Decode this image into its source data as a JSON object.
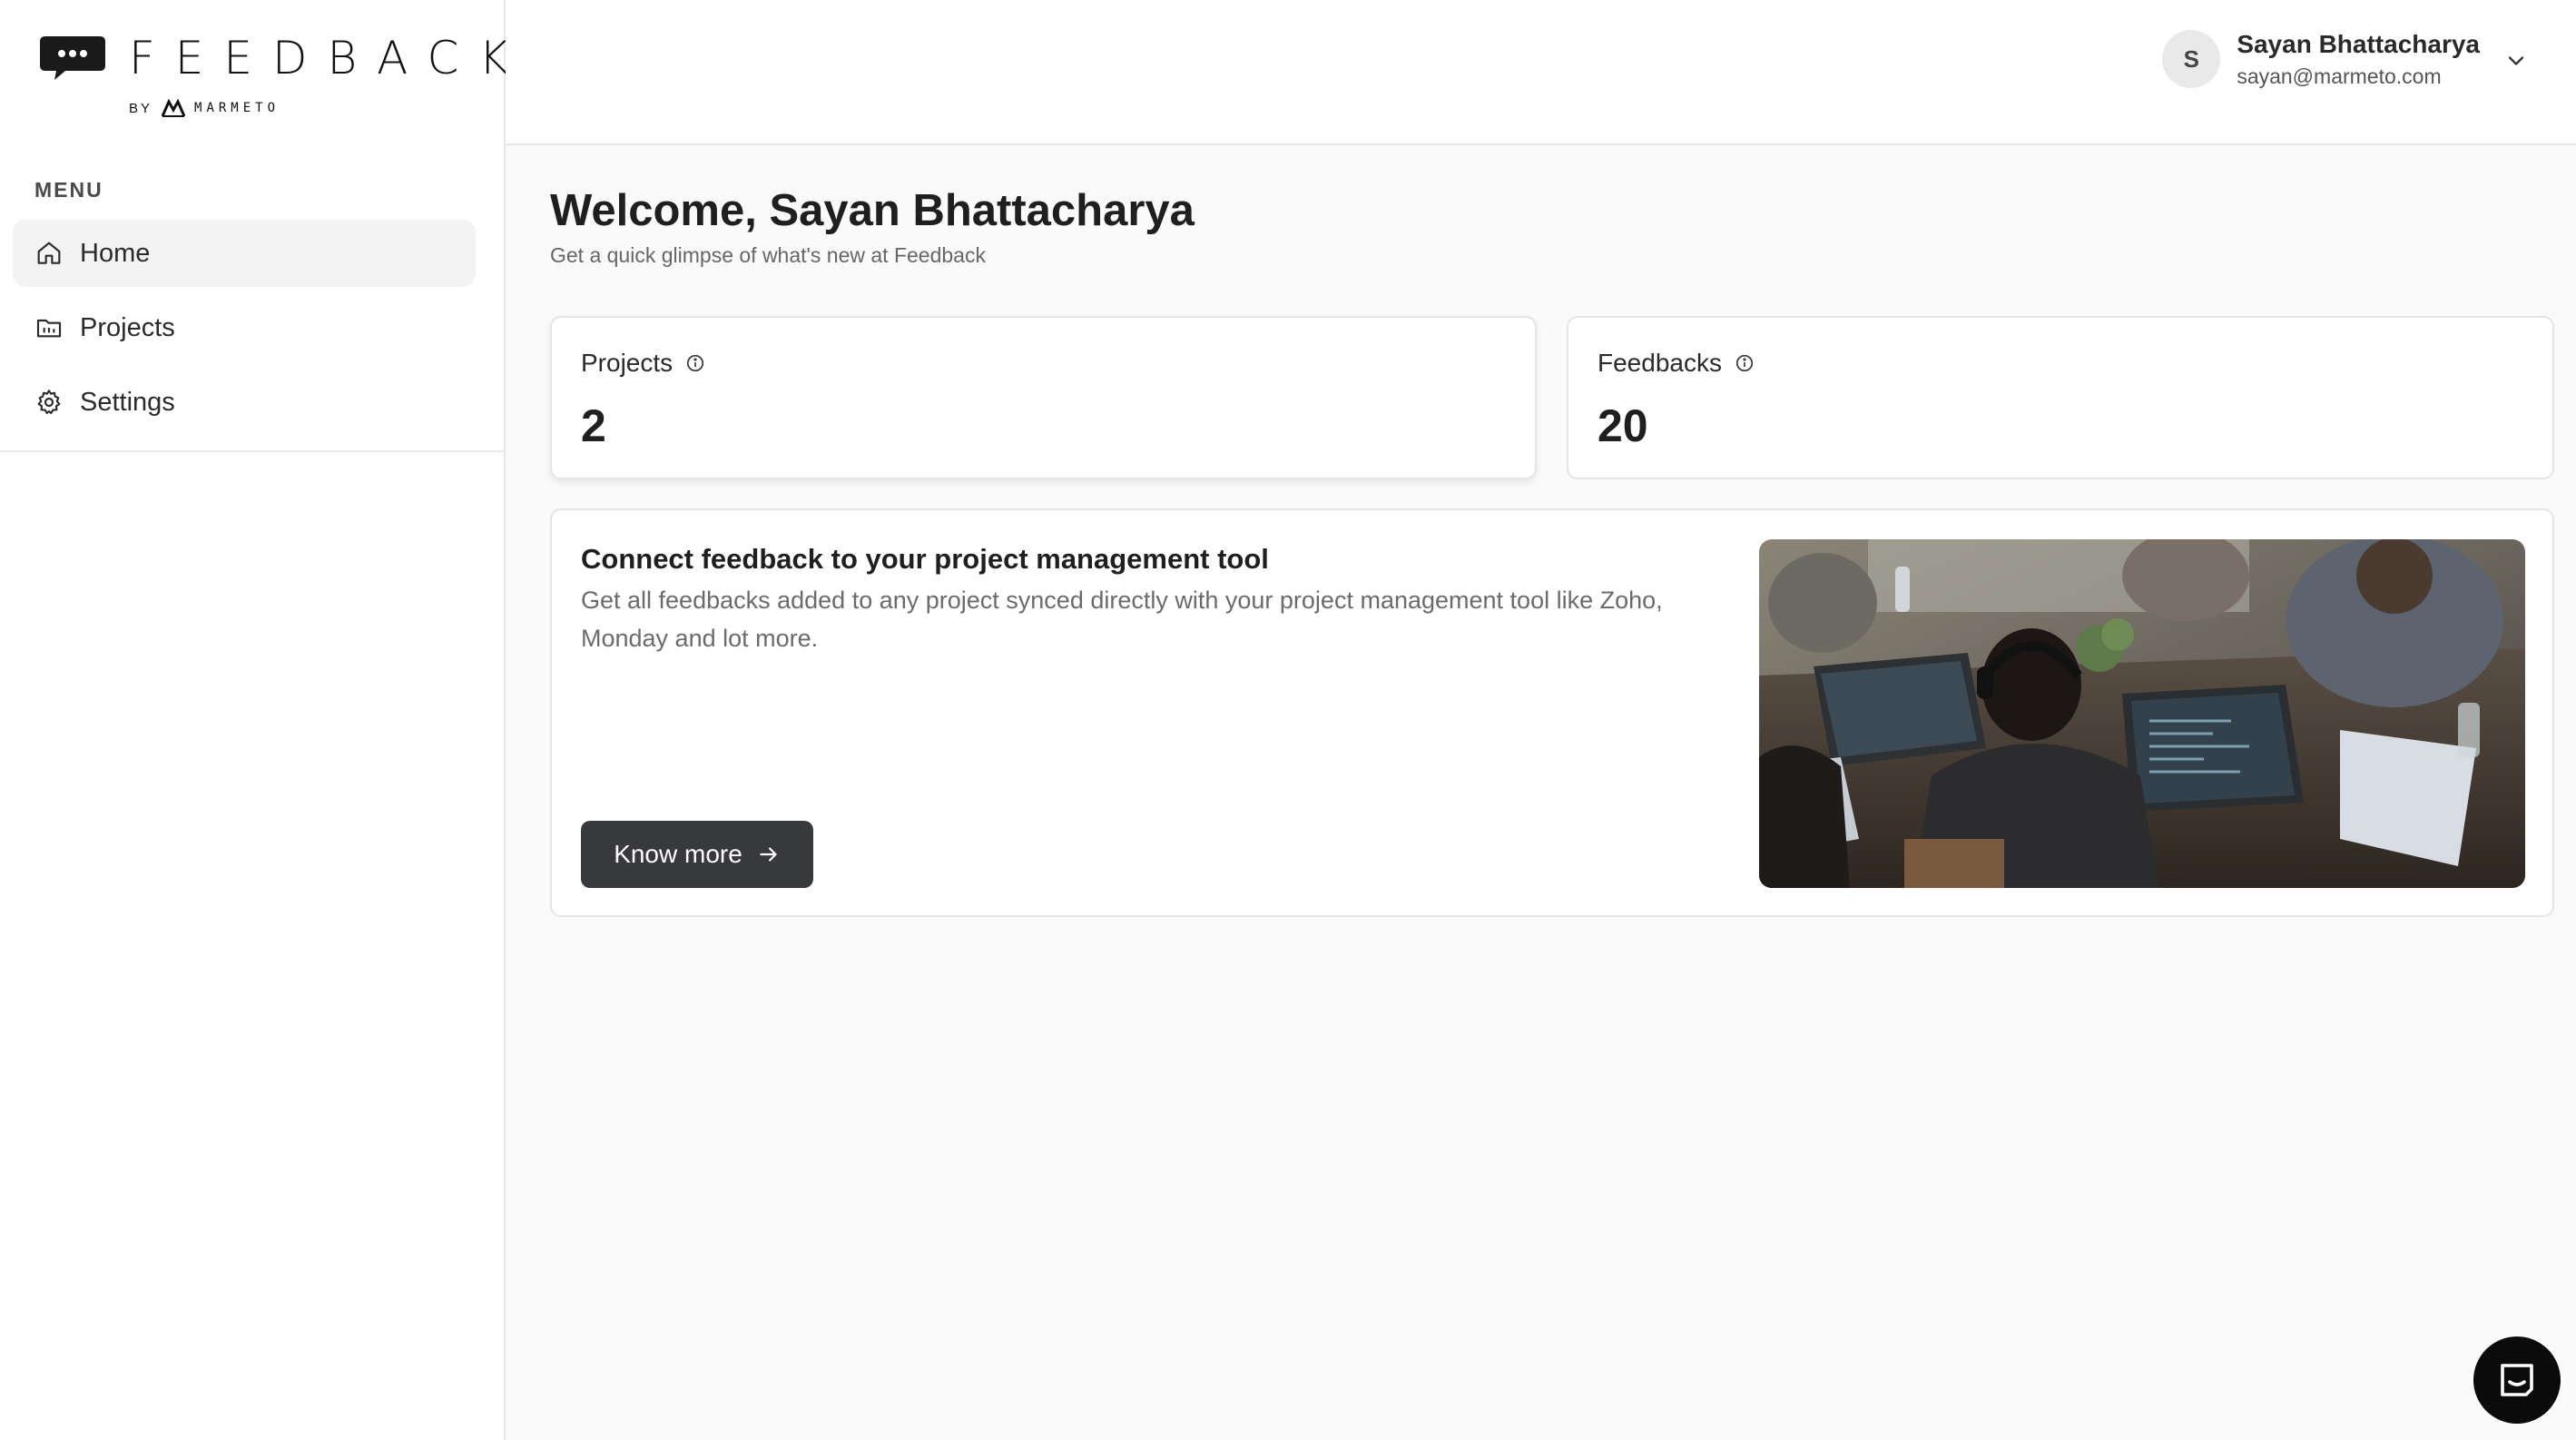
{
  "brand": {
    "wordmark": "FEEDBACK",
    "by_label": "BY",
    "company": "MARMETO"
  },
  "sidebar": {
    "menu_label": "MENU",
    "items": [
      {
        "label": "Home",
        "icon": "home-icon",
        "active": true
      },
      {
        "label": "Projects",
        "icon": "folder-icon",
        "active": false
      },
      {
        "label": "Settings",
        "icon": "gear-icon",
        "active": false
      }
    ]
  },
  "user": {
    "initial": "S",
    "name": "Sayan Bhattacharya",
    "email": "sayan@marmeto.com"
  },
  "main": {
    "welcome": "Welcome, Sayan Bhattacharya",
    "subtitle": "Get a quick glimpse of what's new at Feedback"
  },
  "stats": [
    {
      "label": "Projects",
      "value": "2",
      "icon": "info-icon"
    },
    {
      "label": "Feedbacks",
      "value": "20",
      "icon": "info-icon"
    }
  ],
  "promo": {
    "title": "Connect feedback to your project management tool",
    "description": "Get all feedbacks added to any project synced directly with your project management tool like Zoho, Monday and lot more.",
    "cta_label": "Know more",
    "cta_icon": "arrow-right-icon",
    "image": "people-working-on-laptops-photo"
  },
  "colors": {
    "page_bg": "#fafafa",
    "surface": "#ffffff",
    "border": "#e5e5e5",
    "active_nav": "#f3f3f3",
    "button_bg": "#38393d",
    "chat_bg": "#0b0b0b"
  }
}
